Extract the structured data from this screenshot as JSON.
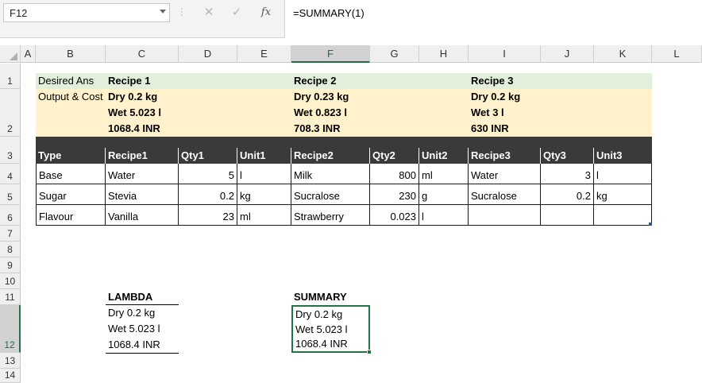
{
  "formula_bar": {
    "name_box": "F12",
    "formula": "=SUMMARY(1)",
    "fx_label": "fx"
  },
  "columns": [
    "A",
    "B",
    "C",
    "D",
    "E",
    "F",
    "G",
    "H",
    "I",
    "J",
    "K",
    "L"
  ],
  "selected_column": "F",
  "rows": [
    "1",
    "2",
    "3",
    "4",
    "5",
    "6",
    "7",
    "8",
    "9",
    "10",
    "11",
    "12",
    "13",
    "14"
  ],
  "selected_row": "12",
  "row1": {
    "b": "Desired Ans",
    "recipe1": "Recipe 1",
    "recipe2": "Recipe 2",
    "recipe3": "Recipe 3"
  },
  "row2": {
    "b": "Output & Cost",
    "recipe1": [
      "Dry 0.2 kg",
      "Wet 5.023 l",
      "1068.4 INR"
    ],
    "recipe2": [
      "Dry 0.23 kg",
      "Wet 0.823 l",
      "708.3 INR"
    ],
    "recipe3": [
      "Dry 0.2 kg",
      "Wet 3 l",
      "630 INR"
    ]
  },
  "table": {
    "headers": [
      "Type",
      "Recipe1",
      "Qty1",
      "Unit1",
      "Recipe2",
      "Qty2",
      "Unit2",
      "Recipe3",
      "Qty3",
      "Unit3"
    ],
    "rows": [
      [
        "Base",
        "Water",
        "5",
        "l",
        "Milk",
        "800",
        "ml",
        "Water",
        "3",
        "l"
      ],
      [
        "Sugar",
        "Stevia",
        "0.2",
        "kg",
        "Sucralose",
        "230",
        "g",
        "Sucralose",
        "0.2",
        "kg"
      ],
      [
        "Flavour",
        "Vanilla",
        "23",
        "ml",
        "Strawberry",
        "0.023",
        "l",
        "",
        "",
        ""
      ]
    ]
  },
  "lambda": {
    "title": "LAMBDA",
    "lines": [
      "Dry 0.2 kg",
      "Wet 5.023 l",
      "1068.4 INR"
    ]
  },
  "summary": {
    "title": "SUMMARY",
    "lines": [
      "Dry 0.2 kg",
      "Wet 5.023 l",
      "1068.4 INR"
    ]
  },
  "colors": {
    "header_fill": "#3a3a3a",
    "green_band": "#e2efda",
    "yellow_band": "#fff2cc",
    "selection": "#217346"
  }
}
